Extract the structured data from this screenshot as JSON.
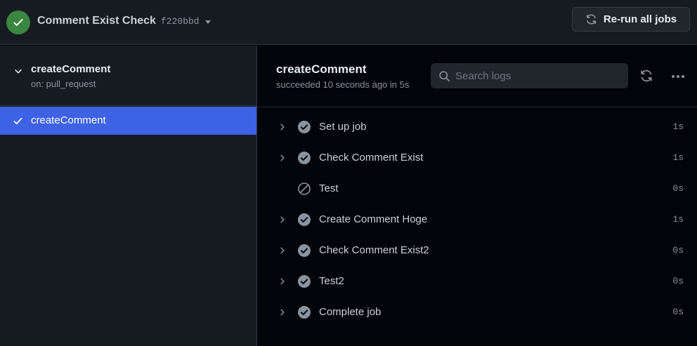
{
  "header": {
    "workflow_title": "Comment Exist Check",
    "commit_sha": "f220bbd",
    "rerun_label": "Re-run all jobs"
  },
  "sidebar": {
    "group_name": "createComment",
    "group_trigger": "on: pull_request",
    "jobs": [
      {
        "label": "createComment",
        "status": "success",
        "selected": true
      }
    ]
  },
  "main": {
    "job_title": "createComment",
    "job_subtitle": "succeeded 10 seconds ago in 5s",
    "search_placeholder": "Search logs",
    "steps": [
      {
        "name": "Set up job",
        "duration": "1s",
        "status": "success",
        "expandable": true
      },
      {
        "name": "Check Comment Exist",
        "duration": "1s",
        "status": "success",
        "expandable": true
      },
      {
        "name": "Test",
        "duration": "0s",
        "status": "skipped",
        "expandable": false
      },
      {
        "name": "Create Comment Hoge",
        "duration": "1s",
        "status": "success",
        "expandable": true
      },
      {
        "name": "Check Comment Exist2",
        "duration": "0s",
        "status": "success",
        "expandable": true
      },
      {
        "name": "Test2",
        "duration": "0s",
        "status": "success",
        "expandable": true
      },
      {
        "name": "Complete job",
        "duration": "0s",
        "status": "success",
        "expandable": true
      }
    ]
  },
  "colors": {
    "success_badge": "#3b8640",
    "selected_job": "#3d62e5",
    "step_icon": "#8b949e"
  },
  "icons": {
    "status": "check-circle-icon",
    "rerun": "sync-icon",
    "search": "search-icon",
    "more": "kebab-horizontal-icon",
    "skipped": "skip-icon"
  }
}
